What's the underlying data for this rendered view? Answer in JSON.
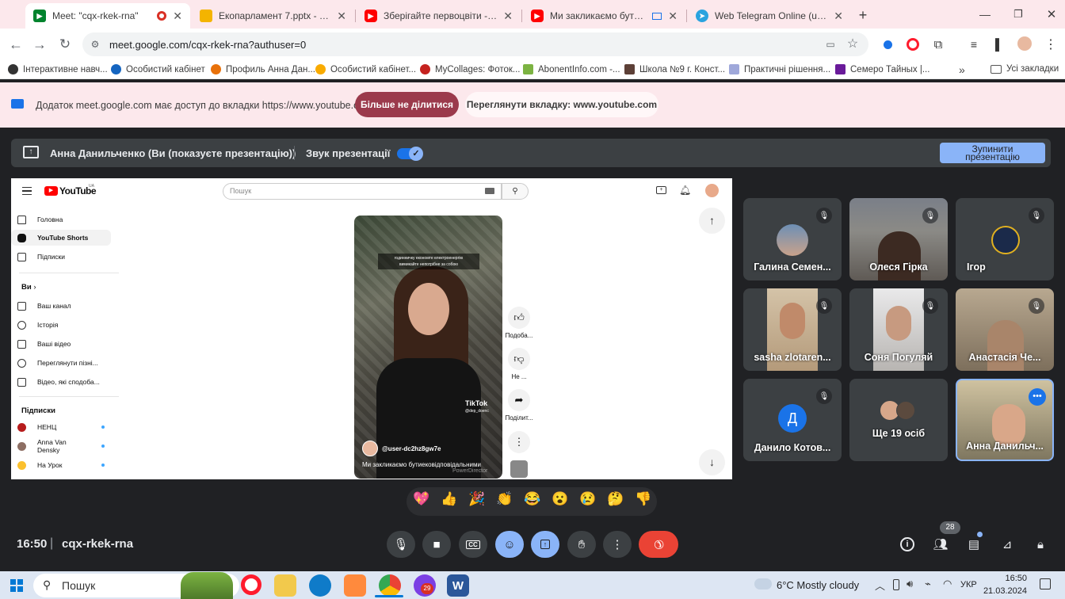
{
  "browser": {
    "tabs": [
      {
        "title": "Meet: \"cqx-rkek-rna\"",
        "active": true
      },
      {
        "title": "Екопарламент 7.pptx - Google"
      },
      {
        "title": "Зберігайте первоцвіти - YouTu"
      },
      {
        "title": "Ми закликаємо бути екові"
      },
      {
        "title": "Web Telegram Online (unoffici"
      }
    ],
    "new_tab": "+",
    "url": "meet.google.com/cqx-rkek-rna?authuser=0",
    "bookmarks": [
      "Інтерактивне навч...",
      "Особистий кабінет",
      "Профиль Анна Дан...",
      "Особистий кабінет...",
      "MyCollages: Фоток...",
      "AbonentInfo.com -...",
      "Школа №9 г. Конст...",
      "Практичні рішення...",
      "Семеро Тайных |..."
    ],
    "bookmarks_more": "»",
    "all_bookmarks": "Усі закладки"
  },
  "infobar": {
    "text": "Додаток meet.google.com має доступ до вкладки https://www.youtube.com",
    "stop_sharing": "Більше не ділитися",
    "view_tab": "Переглянути вкладку: www.youtube.com"
  },
  "presenting": {
    "text": "Анна Данильченко (Ви (показуєте презентацію))",
    "sound_label": "Звук презентації",
    "stop_line1": "Зупинити",
    "stop_line2": "презентацію"
  },
  "youtube": {
    "logo": "YouTube",
    "region": "UA",
    "search_placeholder": "Пошук",
    "sidebar_main": [
      "Головна",
      "YouTube Shorts",
      "Підписки"
    ],
    "you_header": "Ви",
    "sidebar_you": [
      "Ваш канал",
      "Історія",
      "Ваші відео",
      "Переглянути пізні...",
      "Відео, які сподоба..."
    ],
    "subs_header": "Підписки",
    "subs": [
      "НЕНЦ",
      "Anna Van Densky",
      "На Урок"
    ],
    "video": {
      "overlay_line1": "годинничку економте електроенергію",
      "overlay_line2": "вимикайте непотрібне за собою",
      "tiktok": "TikTok",
      "tiktok_handle": "@dep_doenc",
      "channel": "@user-dc2hz8gw7e",
      "caption": "Ми закликаємо бутиековідповідальними",
      "watermark": "PowerDirector"
    },
    "actions": [
      "Подоба...",
      "Не ...",
      "Поділит..."
    ]
  },
  "participants": [
    {
      "name": "Галина Семен...",
      "muted": true
    },
    {
      "name": "Олеся Гірка",
      "muted": true
    },
    {
      "name": "Ігор",
      "muted": true
    },
    {
      "name": "sasha zlotaren...",
      "muted": true
    },
    {
      "name": "Соня Погуляй",
      "muted": true
    },
    {
      "name": "Анастасія Че...",
      "muted": true
    },
    {
      "name": "Данило Котов...",
      "initial": "Д",
      "muted": true
    },
    {
      "name": "Ще 19 осіб"
    },
    {
      "name": "Анна Данильч...",
      "self": true
    }
  ],
  "reactions": [
    "💖",
    "👍",
    "🎉",
    "👏",
    "😂",
    "😮",
    "😢",
    "🤔",
    "👎"
  ],
  "meeting": {
    "time": "16:50",
    "separator": "|",
    "code": "cqx-rkek-rna",
    "people_count": "28"
  },
  "taskbar": {
    "search": "Пошук",
    "badge": "29",
    "weather": "6°C  Mostly cloudy",
    "lang": "УКР",
    "time": "16:50",
    "date": "21.03.2024"
  },
  "colors": {
    "tab_strip": "#fce8ec",
    "meet_bg": "#202124",
    "accent_blue": "#8ab4f8",
    "end_call": "#ea4335",
    "youtube_red": "#ff0000"
  }
}
